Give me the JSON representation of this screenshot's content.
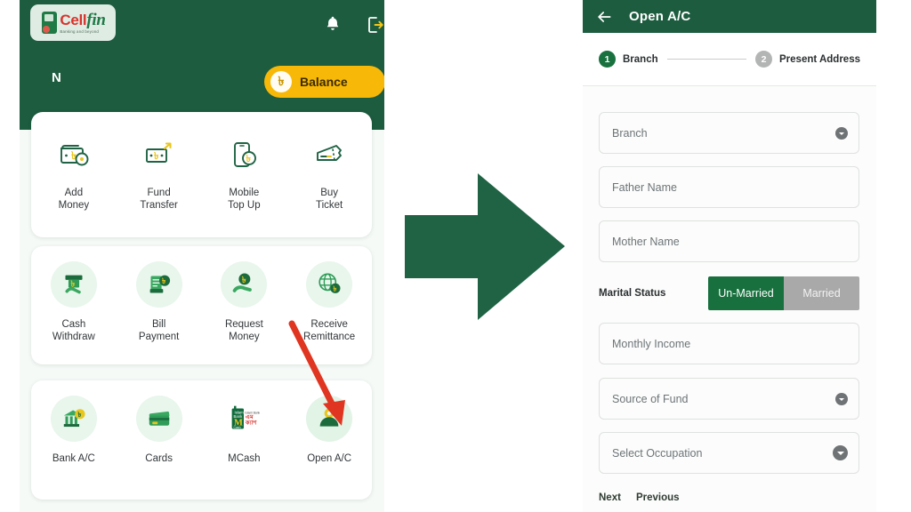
{
  "colors": {
    "brand_green": "#1d5c3f",
    "accent_yellow": "#f8b808",
    "step_active": "#18713f",
    "step_inactive": "#b3b5b4",
    "toggle_on": "#17703d",
    "toggle_off": "#a8a9a8",
    "arrow_green": "#1f6344",
    "annotation_red": "#e03520"
  },
  "left_app": {
    "logo": {
      "cell": "Cell",
      "fin": "fin",
      "tagline": "Banking and beyond"
    },
    "bell_icon": "notification-bell-icon",
    "logout_icon": "logout-icon",
    "greeting_partial": "N",
    "balance_button": {
      "label": "Balance",
      "coin": "৳"
    },
    "rows": [
      {
        "bubble": false,
        "tiles": [
          {
            "label": "Add\nMoney",
            "icon": "wallet-add-money-icon"
          },
          {
            "label": "Fund\nTransfer",
            "icon": "fund-transfer-icon"
          },
          {
            "label": "Mobile\nTop Up",
            "icon": "mobile-topup-icon"
          },
          {
            "label": "Buy\nTicket",
            "icon": "buy-ticket-icon"
          }
        ]
      },
      {
        "bubble": true,
        "tiles": [
          {
            "label": "Cash\nWithdraw",
            "icon": "cash-withdraw-icon"
          },
          {
            "label": "Bill\nPayment",
            "icon": "bill-payment-icon"
          },
          {
            "label": "Request\nMoney",
            "icon": "request-money-icon"
          },
          {
            "label": "Receive\nRemittance",
            "icon": "receive-remittance-icon"
          }
        ]
      },
      {
        "bubble": true,
        "tiles": [
          {
            "label": "Bank A/C",
            "icon": "bank-account-icon"
          },
          {
            "label": "Cards",
            "icon": "cards-icon"
          },
          {
            "label": "MCash",
            "icon": "mcash-icon"
          },
          {
            "label": "Open A/C",
            "icon": "open-account-person-icon"
          }
        ]
      }
    ]
  },
  "annotation": {
    "red_arrow": "red-pointer-arrow",
    "flow_arrow": "green-flow-arrow"
  },
  "right_app": {
    "appbar": {
      "back_icon": "back-arrow-icon",
      "title": "Open A/C"
    },
    "stepper": [
      {
        "number": "1",
        "label": "Branch",
        "state": "active"
      },
      {
        "number": "2",
        "label": "Present Address",
        "state": "inactive"
      }
    ],
    "fields": [
      {
        "name": "branch",
        "placeholder": "Branch",
        "value": "",
        "dropdown": true,
        "dropdown_size": "small"
      },
      {
        "name": "father-name",
        "placeholder": "Father Name",
        "value": "",
        "dropdown": false
      },
      {
        "name": "mother-name",
        "placeholder": "Mother Name",
        "value": "",
        "dropdown": false
      },
      {
        "name": "monthly-income",
        "placeholder": "Monthly Income",
        "value": "",
        "dropdown": false
      },
      {
        "name": "source-of-fund",
        "placeholder": "Source of Fund",
        "value": "",
        "dropdown": true,
        "dropdown_size": "small"
      },
      {
        "name": "select-occupation",
        "placeholder": "Select Occupation",
        "value": "",
        "dropdown": true,
        "dropdown_size": "large"
      }
    ],
    "marital_status": {
      "label": "Marital Status",
      "options": [
        "Un-Married",
        "Married"
      ],
      "selected": "Un-Married"
    },
    "nav": {
      "next": "Next",
      "previous": "Previous"
    }
  }
}
